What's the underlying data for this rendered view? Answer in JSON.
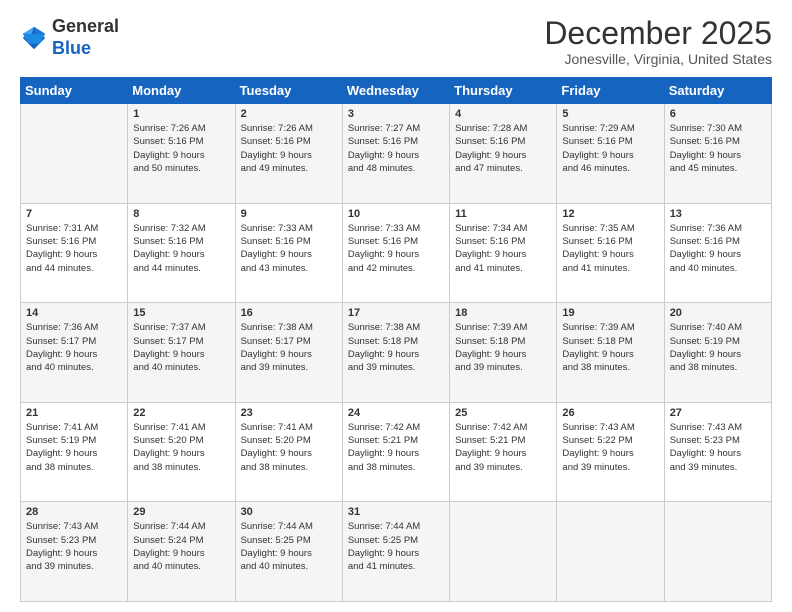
{
  "logo": {
    "general": "General",
    "blue": "Blue"
  },
  "title": "December 2025",
  "location": "Jonesville, Virginia, United States",
  "days_header": [
    "Sunday",
    "Monday",
    "Tuesday",
    "Wednesday",
    "Thursday",
    "Friday",
    "Saturday"
  ],
  "weeks": [
    [
      {
        "day": "",
        "info": ""
      },
      {
        "day": "1",
        "info": "Sunrise: 7:26 AM\nSunset: 5:16 PM\nDaylight: 9 hours\nand 50 minutes."
      },
      {
        "day": "2",
        "info": "Sunrise: 7:26 AM\nSunset: 5:16 PM\nDaylight: 9 hours\nand 49 minutes."
      },
      {
        "day": "3",
        "info": "Sunrise: 7:27 AM\nSunset: 5:16 PM\nDaylight: 9 hours\nand 48 minutes."
      },
      {
        "day": "4",
        "info": "Sunrise: 7:28 AM\nSunset: 5:16 PM\nDaylight: 9 hours\nand 47 minutes."
      },
      {
        "day": "5",
        "info": "Sunrise: 7:29 AM\nSunset: 5:16 PM\nDaylight: 9 hours\nand 46 minutes."
      },
      {
        "day": "6",
        "info": "Sunrise: 7:30 AM\nSunset: 5:16 PM\nDaylight: 9 hours\nand 45 minutes."
      }
    ],
    [
      {
        "day": "7",
        "info": "Sunrise: 7:31 AM\nSunset: 5:16 PM\nDaylight: 9 hours\nand 44 minutes."
      },
      {
        "day": "8",
        "info": "Sunrise: 7:32 AM\nSunset: 5:16 PM\nDaylight: 9 hours\nand 44 minutes."
      },
      {
        "day": "9",
        "info": "Sunrise: 7:33 AM\nSunset: 5:16 PM\nDaylight: 9 hours\nand 43 minutes."
      },
      {
        "day": "10",
        "info": "Sunrise: 7:33 AM\nSunset: 5:16 PM\nDaylight: 9 hours\nand 42 minutes."
      },
      {
        "day": "11",
        "info": "Sunrise: 7:34 AM\nSunset: 5:16 PM\nDaylight: 9 hours\nand 41 minutes."
      },
      {
        "day": "12",
        "info": "Sunrise: 7:35 AM\nSunset: 5:16 PM\nDaylight: 9 hours\nand 41 minutes."
      },
      {
        "day": "13",
        "info": "Sunrise: 7:36 AM\nSunset: 5:16 PM\nDaylight: 9 hours\nand 40 minutes."
      }
    ],
    [
      {
        "day": "14",
        "info": "Sunrise: 7:36 AM\nSunset: 5:17 PM\nDaylight: 9 hours\nand 40 minutes."
      },
      {
        "day": "15",
        "info": "Sunrise: 7:37 AM\nSunset: 5:17 PM\nDaylight: 9 hours\nand 40 minutes."
      },
      {
        "day": "16",
        "info": "Sunrise: 7:38 AM\nSunset: 5:17 PM\nDaylight: 9 hours\nand 39 minutes."
      },
      {
        "day": "17",
        "info": "Sunrise: 7:38 AM\nSunset: 5:18 PM\nDaylight: 9 hours\nand 39 minutes."
      },
      {
        "day": "18",
        "info": "Sunrise: 7:39 AM\nSunset: 5:18 PM\nDaylight: 9 hours\nand 39 minutes."
      },
      {
        "day": "19",
        "info": "Sunrise: 7:39 AM\nSunset: 5:18 PM\nDaylight: 9 hours\nand 38 minutes."
      },
      {
        "day": "20",
        "info": "Sunrise: 7:40 AM\nSunset: 5:19 PM\nDaylight: 9 hours\nand 38 minutes."
      }
    ],
    [
      {
        "day": "21",
        "info": "Sunrise: 7:41 AM\nSunset: 5:19 PM\nDaylight: 9 hours\nand 38 minutes."
      },
      {
        "day": "22",
        "info": "Sunrise: 7:41 AM\nSunset: 5:20 PM\nDaylight: 9 hours\nand 38 minutes."
      },
      {
        "day": "23",
        "info": "Sunrise: 7:41 AM\nSunset: 5:20 PM\nDaylight: 9 hours\nand 38 minutes."
      },
      {
        "day": "24",
        "info": "Sunrise: 7:42 AM\nSunset: 5:21 PM\nDaylight: 9 hours\nand 38 minutes."
      },
      {
        "day": "25",
        "info": "Sunrise: 7:42 AM\nSunset: 5:21 PM\nDaylight: 9 hours\nand 39 minutes."
      },
      {
        "day": "26",
        "info": "Sunrise: 7:43 AM\nSunset: 5:22 PM\nDaylight: 9 hours\nand 39 minutes."
      },
      {
        "day": "27",
        "info": "Sunrise: 7:43 AM\nSunset: 5:23 PM\nDaylight: 9 hours\nand 39 minutes."
      }
    ],
    [
      {
        "day": "28",
        "info": "Sunrise: 7:43 AM\nSunset: 5:23 PM\nDaylight: 9 hours\nand 39 minutes."
      },
      {
        "day": "29",
        "info": "Sunrise: 7:44 AM\nSunset: 5:24 PM\nDaylight: 9 hours\nand 40 minutes."
      },
      {
        "day": "30",
        "info": "Sunrise: 7:44 AM\nSunset: 5:25 PM\nDaylight: 9 hours\nand 40 minutes."
      },
      {
        "day": "31",
        "info": "Sunrise: 7:44 AM\nSunset: 5:25 PM\nDaylight: 9 hours\nand 41 minutes."
      },
      {
        "day": "",
        "info": ""
      },
      {
        "day": "",
        "info": ""
      },
      {
        "day": "",
        "info": ""
      }
    ]
  ]
}
